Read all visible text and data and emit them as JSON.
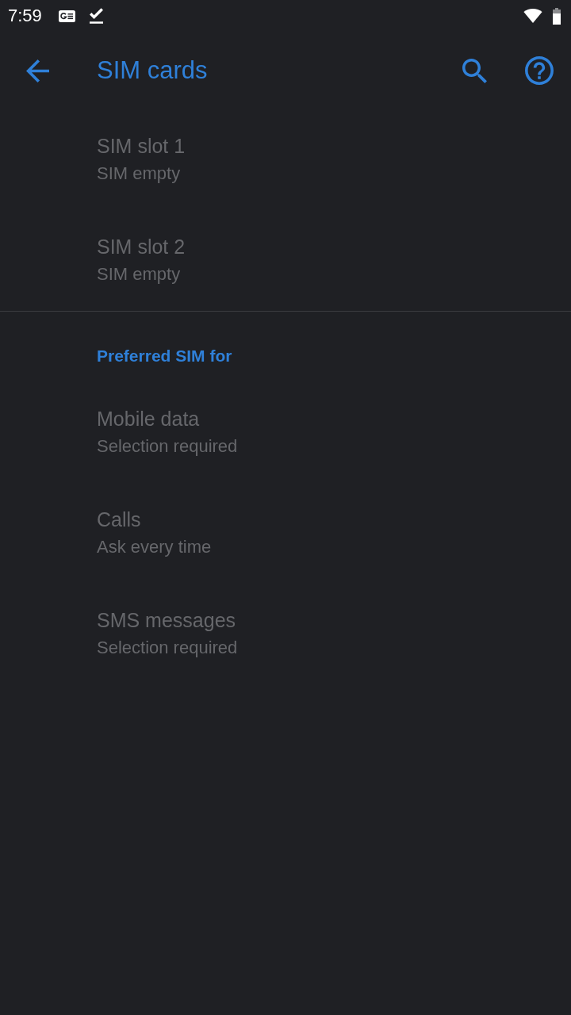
{
  "status_bar": {
    "time": "7:59"
  },
  "app_bar": {
    "title": "SIM cards"
  },
  "sim_slots": [
    {
      "title": "SIM slot 1",
      "summary": "SIM empty",
      "disabled": true
    },
    {
      "title": "SIM slot 2",
      "summary": "SIM empty",
      "disabled": true
    }
  ],
  "preferred_sim": {
    "header": "Preferred SIM for",
    "items": [
      {
        "title": "Mobile data",
        "summary": "Selection required",
        "disabled": true
      },
      {
        "title": "Calls",
        "summary": "Ask every time",
        "disabled": true
      },
      {
        "title": "SMS messages",
        "summary": "Selection required",
        "disabled": true
      }
    ]
  }
}
